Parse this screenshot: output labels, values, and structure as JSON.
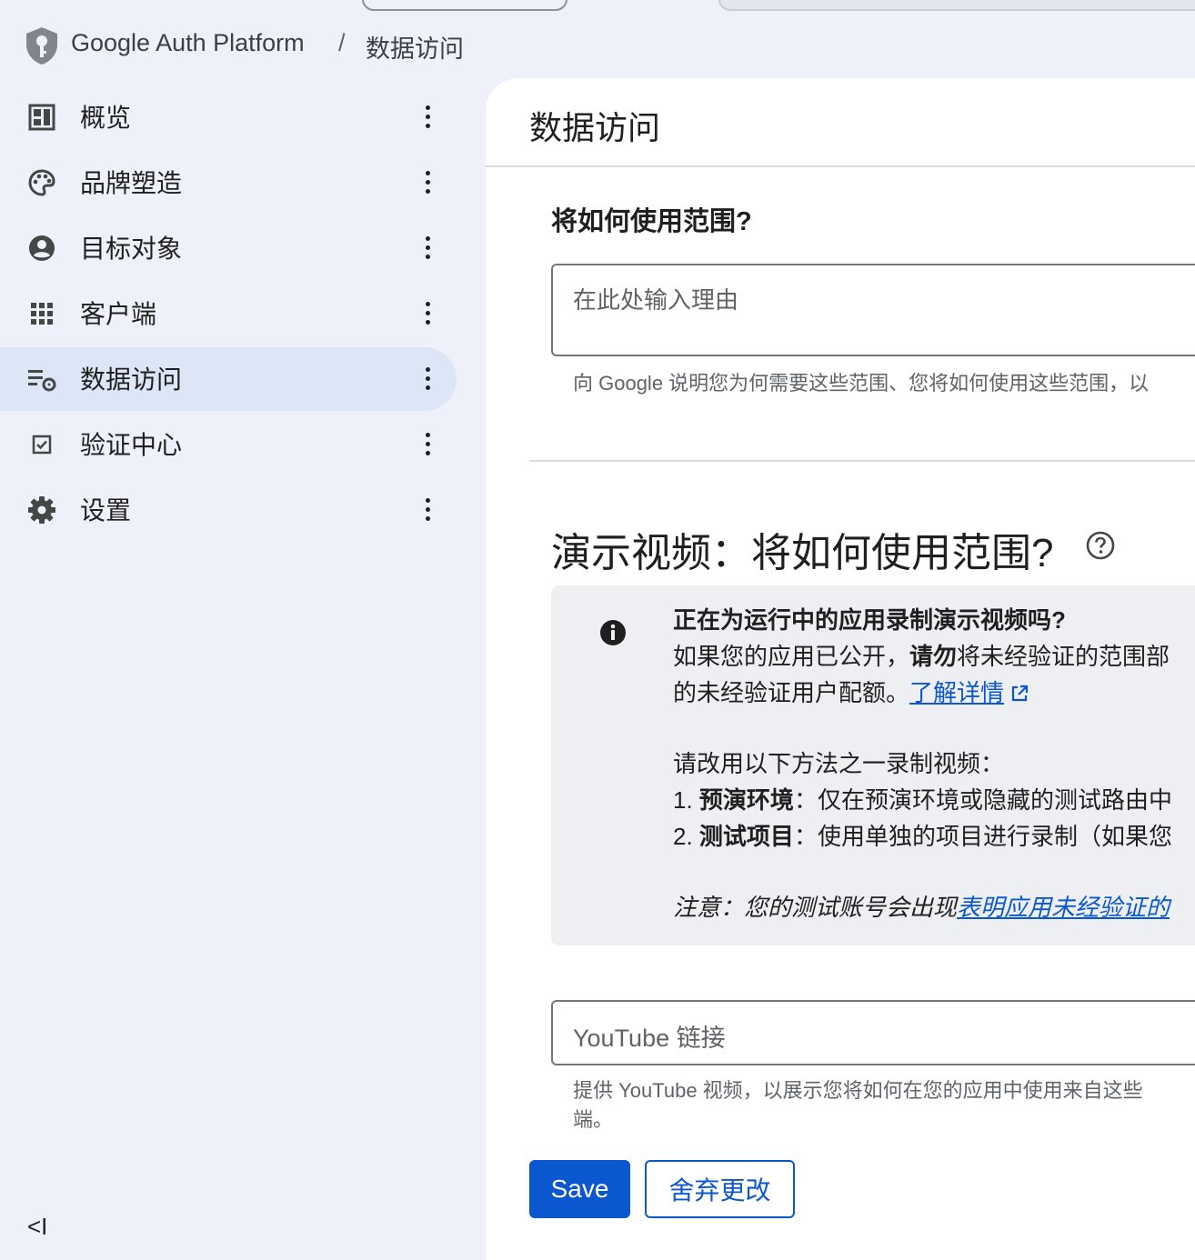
{
  "breadcrumb": {
    "platform": "Google Auth Platform",
    "separator": "/",
    "current": "数据访问"
  },
  "sidebar": {
    "items": [
      {
        "label": "概览",
        "icon": "dashboard-icon",
        "active": false
      },
      {
        "label": "品牌塑造",
        "icon": "palette-icon",
        "active": false
      },
      {
        "label": "目标对象",
        "icon": "account-circle-icon",
        "active": false
      },
      {
        "label": "客户端",
        "icon": "apps-grid-icon",
        "active": false
      },
      {
        "label": "数据访问",
        "icon": "data-access-icon",
        "active": true
      },
      {
        "label": "验证中心",
        "icon": "checkbox-icon",
        "active": false
      },
      {
        "label": "设置",
        "icon": "gear-icon",
        "active": false
      }
    ],
    "collapse_label": "<I"
  },
  "main": {
    "title": "数据访问",
    "usage_question": "将如何使用范围?",
    "reason_placeholder": "在此处输入理由",
    "reason_help": "向 Google 说明您为何需要这些范围、您将如何使用这些范围，以",
    "video_title": "演示视频：将如何使用范围?",
    "info": {
      "heading": "正在为运行中的应用录制演示视频吗?",
      "line1_a": "如果您的应用已公开，",
      "line1_b": "请勿",
      "line1_c": "将未经验证的范围部",
      "line2_a": "的未经验证用户配额。",
      "learn_more": "了解详情",
      "line3": "请改用以下方法之一录制视频：",
      "item1_num": "1. ",
      "item1_bold": "预演环境",
      "item1_text": "：仅在预演环境或隐藏的测试路由中",
      "item2_num": "2. ",
      "item2_bold": "测试项目",
      "item2_text": "：使用单独的项目进行录制（如果您",
      "note_a": "注意：您的测试账号会出现",
      "note_link": "表明应用未经验证的"
    },
    "youtube_placeholder": "YouTube 链接",
    "youtube_help_1": "提供 YouTube 视频，以展示您将如何在您的应用中使用来自这些",
    "youtube_help_2": "端。",
    "save_label": "Save",
    "discard_label": "舍弃更改"
  },
  "colors": {
    "accent": "#0b57d0",
    "sidebar_active": "#dce6f6",
    "background": "#eef1f9",
    "info_box": "#edeff3"
  }
}
